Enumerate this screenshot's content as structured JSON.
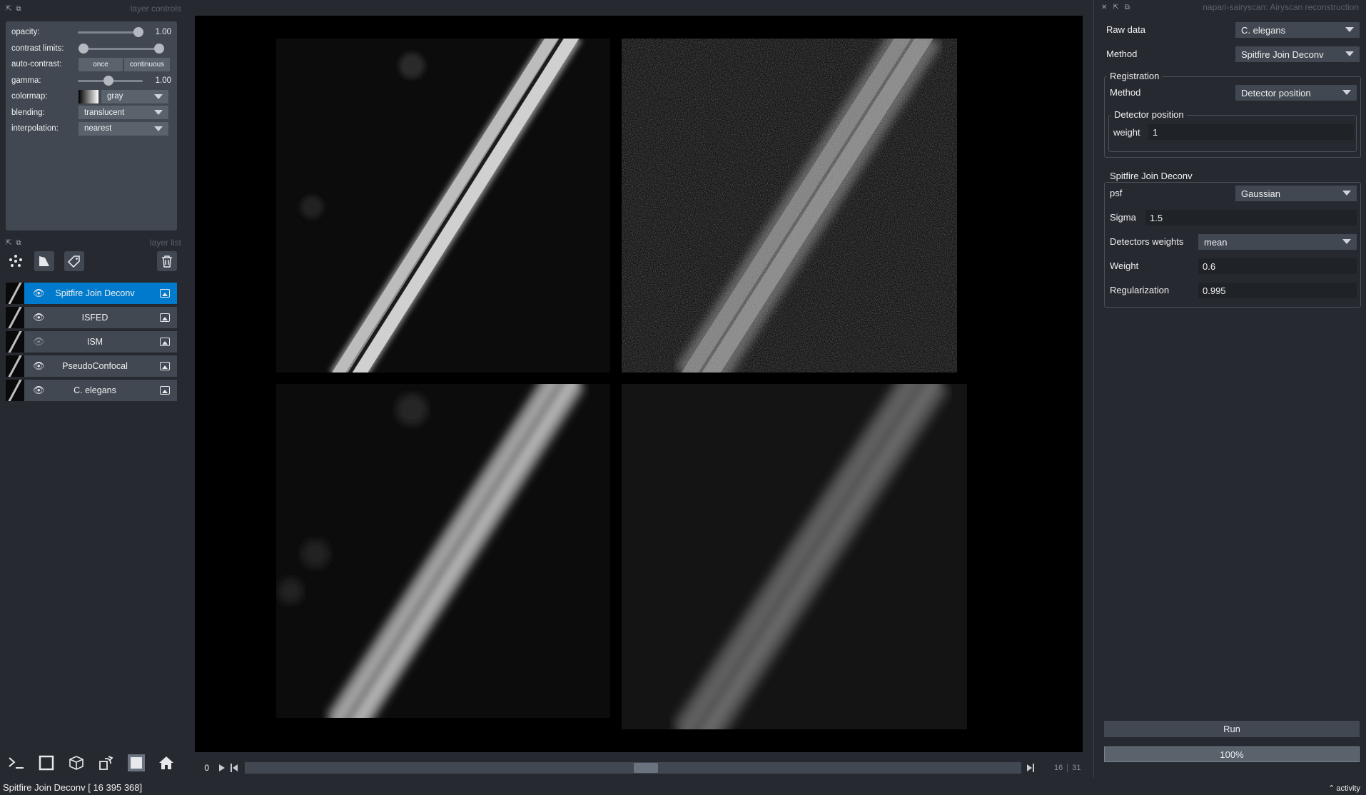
{
  "left_panel": {
    "controls_title": "layer controls",
    "list_title": "layer list",
    "controls": {
      "opacity_label": "opacity:",
      "opacity_value": "1.00",
      "opacity_level": 1.0,
      "contrast_label": "contrast limits:",
      "contrast_range": [
        0,
        1
      ],
      "autocontrast_label": "auto-contrast:",
      "once_label": "once",
      "continuous_label": "continuous",
      "gamma_label": "gamma:",
      "gamma_value": "1.00",
      "gamma_level": 0.5,
      "colormap_label": "colormap:",
      "colormap_value": "gray",
      "blending_label": "blending:",
      "blending_value": "translucent",
      "interpolation_label": "interpolation:",
      "interpolation_value": "nearest"
    },
    "layers": [
      {
        "name": "Spitfire Join Deconv",
        "visible": true,
        "selected": true
      },
      {
        "name": "ISFED",
        "visible": true,
        "selected": false
      },
      {
        "name": "ISM",
        "visible": false,
        "selected": false
      },
      {
        "name": "PseudoConfocal",
        "visible": true,
        "selected": false
      },
      {
        "name": "C. elegans",
        "visible": true,
        "selected": false
      }
    ]
  },
  "dims": {
    "current": "0",
    "slider_level": 0.5,
    "value": "16",
    "max": "31"
  },
  "right_panel": {
    "title": "napari-sairyscan: Airyscan reconstruction",
    "raw_data_label": "Raw data",
    "raw_data_value": "C. elegans",
    "method_label": "Method",
    "method_value": "Spitfire Join Deconv",
    "registration": {
      "title": "Registration",
      "method_label": "Method",
      "method_value": "Detector position",
      "detector_title": "Detector position",
      "weight_label": "weight",
      "weight_value": "1"
    },
    "deconv": {
      "title": "Spitfire Join Deconv",
      "psf_label": "psf",
      "psf_value": "Gaussian",
      "sigma_label": "Sigma",
      "sigma_value": "1.5",
      "detweights_label": "Detectors weights",
      "detweights_value": "mean",
      "weight_label": "Weight",
      "weight_value": "0.6",
      "reg_label": "Regularization",
      "reg_value": "0.995"
    },
    "run_label": "Run",
    "progress_label": "100%",
    "progress_level": 1.0
  },
  "status": {
    "text": "Spitfire Join Deconv [ 16 395 368]",
    "activity": "activity"
  },
  "icons": {
    "points": "scatter-dots-icon",
    "shapes": "polygon-icon",
    "labels": "tag-icon",
    "delete": "trash-icon"
  }
}
